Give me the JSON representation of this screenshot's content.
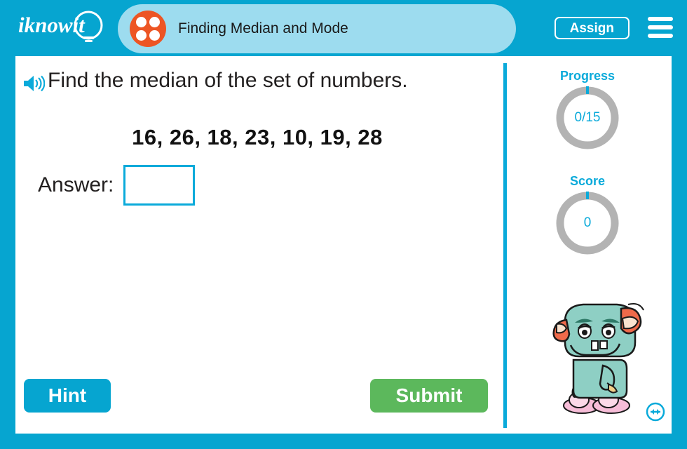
{
  "app": {
    "brand": "iknowit",
    "accent_blue": "#06a5d0",
    "light_blue": "#9ddcef",
    "orange": "#ed5524",
    "green": "#5cb85c",
    "gray_ring": "#b3b3b3"
  },
  "header": {
    "logo_text": "iknowit",
    "logo_icon": "lightbulb-icon",
    "lesson_icon": "dice-four-icon",
    "lesson_title": "Finding Median and Mode",
    "assign_label": "Assign",
    "menu_icon": "hamburger-menu-icon"
  },
  "question": {
    "audio_icon": "speaker-icon",
    "prompt": "Find the median of the set of numbers.",
    "numbers": "16, 26, 18, 23, 10, 19, 28",
    "answer_label": "Answer:",
    "answer_value": "",
    "answer_placeholder": ""
  },
  "actions": {
    "hint_label": "Hint",
    "submit_label": "Submit"
  },
  "panel": {
    "progress_label": "Progress",
    "progress_value": "0/15",
    "score_label": "Score",
    "score_value": "0",
    "mascot_name": "teal-monster-mascot",
    "resize_icon": "resize-horizontal-icon"
  }
}
